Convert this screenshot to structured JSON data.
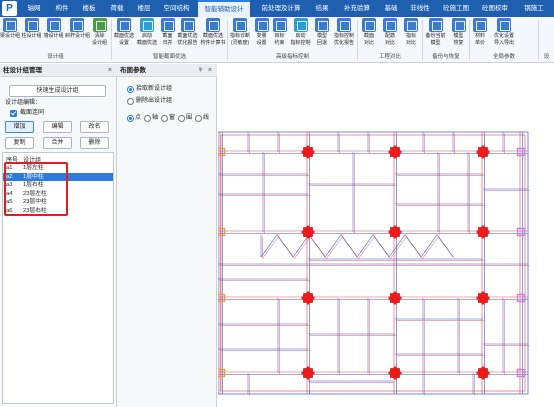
{
  "app": {
    "logo": "P"
  },
  "tabs": [
    {
      "label": "轴网"
    },
    {
      "label": "构件"
    },
    {
      "label": "楼板"
    },
    {
      "label": "荷载"
    },
    {
      "label": "楼层"
    },
    {
      "label": "空间结构"
    },
    {
      "label": "智能辅助设计"
    },
    {
      "label": "前处理及计算"
    },
    {
      "label": "结果"
    },
    {
      "label": "补充验算"
    },
    {
      "label": "基础"
    },
    {
      "label": "非线性"
    },
    {
      "label": "砼施工图"
    },
    {
      "label": "砼图校审"
    },
    {
      "label": "钢施工"
    }
  ],
  "ribbon": {
    "buttons": [
      {
        "label": "梁设计组",
        "icon": "beam-group-icon"
      },
      {
        "label": "柱设计组",
        "icon": "column-group-icon"
      },
      {
        "label": "墙设计组",
        "icon": "wall-group-icon"
      },
      {
        "label": "斜杆设计组",
        "icon": "brace-group-icon"
      },
      {
        "label": "清除",
        "label2": "设计组",
        "icon": "clear-icon"
      },
      {
        "label": "截面优选",
        "label2": "设置",
        "icon": "section-settings-icon"
      },
      {
        "label": "启动",
        "label2": "截面优选",
        "icon": "start-icon"
      },
      {
        "label": "截面",
        "label2": "归并",
        "icon": "merge-icon"
      },
      {
        "label": "截面优选",
        "label2": "优化报告",
        "icon": "report-icon"
      },
      {
        "label": "截面优选",
        "label2": "构件计算书",
        "icon": "calc-book-icon"
      },
      {
        "label": "指标诊断",
        "label2": "(灵敏度)",
        "icon": "diagnosis-icon"
      },
      {
        "label": "变量",
        "label2": "设置",
        "icon": "variable-icon"
      },
      {
        "label": "目标",
        "label2": "约束",
        "icon": "target-icon"
      },
      {
        "label": "启动",
        "label2": "指标控制",
        "icon": "start-control-icon"
      },
      {
        "label": "模型",
        "label2": "回退",
        "icon": "rollback-icon"
      },
      {
        "label": "指标控制",
        "label2": "优化报告",
        "icon": "control-report-icon"
      },
      {
        "label": "截面",
        "label2": "对比",
        "icon": "section-compare-icon"
      },
      {
        "label": "配筋",
        "label2": "对比",
        "icon": "rebar-compare-icon"
      },
      {
        "label": "指标",
        "label2": "对比",
        "icon": "index-compare-icon"
      },
      {
        "label": "备份当前",
        "label2": "模型",
        "icon": "backup-icon"
      },
      {
        "label": "模型",
        "label2": "恢复",
        "icon": "restore-icon"
      },
      {
        "label": "材料",
        "label2": "单价",
        "icon": "material-icon"
      },
      {
        "label": "优化设置",
        "label2": "导入导出",
        "icon": "import-export-icon"
      }
    ],
    "groups": [
      {
        "label": "设计组"
      },
      {
        "label": "智能截面优选"
      },
      {
        "label": "高级指标控制"
      },
      {
        "label": "工程对比"
      },
      {
        "label": "备份与恢复"
      },
      {
        "label": "全局参数"
      },
      {
        "label": "设"
      }
    ]
  },
  "left_panel": {
    "title": "柱设计组管理",
    "close": "×",
    "quick_button": "快速生成设计组",
    "edit_label": "设计组编辑：",
    "checkbox_label": "截面连同",
    "buttons": {
      "add": "增加",
      "edit": "编辑",
      "rename": "改名",
      "copy": "复制",
      "merge": "合并",
      "delete": "删除"
    },
    "list": {
      "headers": {
        "no": "序号",
        "name": "设计组"
      },
      "rows": [
        {
          "no": "a1",
          "name": "1层左柱"
        },
        {
          "no": "a2",
          "name": "1层中柱"
        },
        {
          "no": "a3",
          "name": "1层右柱"
        },
        {
          "no": "a4",
          "name": "23层左柱"
        },
        {
          "no": "a5",
          "name": "23层中柱"
        },
        {
          "no": "a6",
          "name": "23层右柱"
        }
      ],
      "selected_index": 1
    }
  },
  "mid_panel": {
    "title": "布图参数",
    "pin": "ᵠ",
    "close": "×",
    "radio_add": "拾取新设计组",
    "radio_remove": "删除出设计组",
    "modes": [
      {
        "label": "点"
      },
      {
        "label": "轴"
      },
      {
        "label": "窗"
      },
      {
        "label": "围"
      },
      {
        "label": "线"
      }
    ]
  },
  "canvas": {
    "colors": {
      "column_red": "#ee1a1a",
      "column_orange": "#f29a3c",
      "column_magenta": "#d07be0",
      "grid_blue": "#3a55d8",
      "grid_red": "#d94a4a"
    }
  }
}
